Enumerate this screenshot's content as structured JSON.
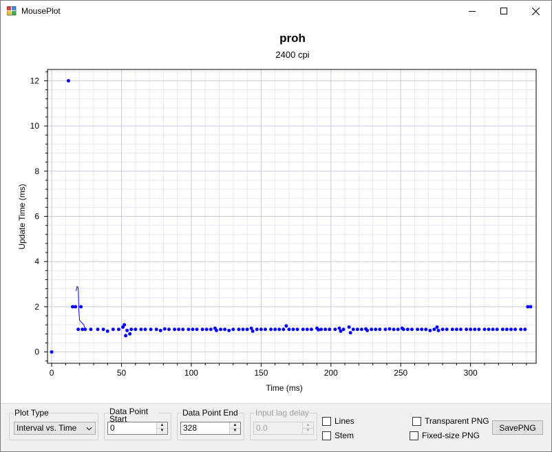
{
  "window": {
    "title": "MousePlot"
  },
  "chart": {
    "title": "proh",
    "subtitle": "2400 cpi",
    "xlabel": "Time (ms)",
    "ylabel": "Update Time (ms)",
    "xticks": [
      "0",
      "50",
      "100",
      "150",
      "200",
      "250",
      "300"
    ],
    "yticks": [
      "0",
      "2",
      "4",
      "6",
      "8",
      "10",
      "12"
    ],
    "point_color": "#0000ff"
  },
  "chart_data": {
    "type": "scatter",
    "title": "proh",
    "subtitle": "2400 cpi",
    "xlabel": "Time (ms)",
    "ylabel": "Update Time (ms)",
    "xlim": [
      -3,
      347
    ],
    "ylim": [
      -0.5,
      12.5
    ],
    "grid": true,
    "points": [
      [
        0,
        0
      ],
      [
        12,
        12
      ],
      [
        15,
        2
      ],
      [
        17,
        2
      ],
      [
        19,
        1
      ],
      [
        21,
        2
      ],
      [
        22,
        1
      ],
      [
        24,
        1
      ],
      [
        28,
        1
      ],
      [
        33,
        1
      ],
      [
        37,
        1
      ],
      [
        40,
        0.92
      ],
      [
        44,
        1
      ],
      [
        48,
        1
      ],
      [
        51,
        1.1
      ],
      [
        52,
        1.2
      ],
      [
        53,
        0.72
      ],
      [
        54,
        0.95
      ],
      [
        56,
        0.8
      ],
      [
        57,
        1
      ],
      [
        60,
        1
      ],
      [
        64,
        1
      ],
      [
        67,
        1
      ],
      [
        71,
        1
      ],
      [
        75,
        1
      ],
      [
        78,
        0.95
      ],
      [
        81,
        1.02
      ],
      [
        84,
        1
      ],
      [
        88,
        1
      ],
      [
        91,
        1
      ],
      [
        94,
        1
      ],
      [
        98,
        1
      ],
      [
        101,
        1
      ],
      [
        104,
        1
      ],
      [
        108,
        1
      ],
      [
        111,
        1
      ],
      [
        114,
        1
      ],
      [
        117,
        1.05
      ],
      [
        118,
        0.95
      ],
      [
        121,
        1
      ],
      [
        124,
        1
      ],
      [
        127,
        0.95
      ],
      [
        130,
        1
      ],
      [
        134,
        1
      ],
      [
        137,
        1
      ],
      [
        140,
        1
      ],
      [
        143,
        1.05
      ],
      [
        144,
        0.92
      ],
      [
        147,
        1
      ],
      [
        150,
        1
      ],
      [
        153,
        1
      ],
      [
        157,
        1
      ],
      [
        160,
        1
      ],
      [
        163,
        1
      ],
      [
        166,
        1
      ],
      [
        168,
        1.15
      ],
      [
        170,
        1
      ],
      [
        173,
        1
      ],
      [
        176,
        1
      ],
      [
        180,
        1
      ],
      [
        183,
        1
      ],
      [
        186,
        1
      ],
      [
        190,
        1.05
      ],
      [
        191,
        0.98
      ],
      [
        193,
        1
      ],
      [
        196,
        1
      ],
      [
        199,
        1
      ],
      [
        203,
        1
      ],
      [
        206,
        1.05
      ],
      [
        207,
        0.92
      ],
      [
        209,
        1
      ],
      [
        213,
        1.1
      ],
      [
        214,
        0.85
      ],
      [
        216,
        1
      ],
      [
        219,
        1
      ],
      [
        222,
        1
      ],
      [
        225,
        1.02
      ],
      [
        226,
        0.95
      ],
      [
        229,
        1
      ],
      [
        232,
        1
      ],
      [
        235,
        1
      ],
      [
        239,
        1
      ],
      [
        242,
        1.02
      ],
      [
        245,
        1
      ],
      [
        248,
        1
      ],
      [
        251,
        1.05
      ],
      [
        252,
        1
      ],
      [
        255,
        1
      ],
      [
        258,
        1
      ],
      [
        262,
        1
      ],
      [
        265,
        1
      ],
      [
        268,
        1
      ],
      [
        271,
        0.95
      ],
      [
        274,
        1
      ],
      [
        276,
        1.1
      ],
      [
        277,
        0.95
      ],
      [
        280,
        1
      ],
      [
        283,
        1
      ],
      [
        287,
        1
      ],
      [
        290,
        1
      ],
      [
        293,
        1
      ],
      [
        297,
        1
      ],
      [
        300,
        1
      ],
      [
        303,
        1
      ],
      [
        306,
        1
      ],
      [
        310,
        1
      ],
      [
        313,
        1
      ],
      [
        316,
        1
      ],
      [
        319,
        1
      ],
      [
        323,
        1
      ],
      [
        326,
        1
      ],
      [
        329,
        1
      ],
      [
        332,
        1
      ],
      [
        336,
        1
      ],
      [
        339,
        1
      ],
      [
        341,
        2
      ],
      [
        343,
        2
      ]
    ],
    "line": [
      [
        17.5,
        2.7
      ],
      [
        18.2,
        2.9
      ],
      [
        19,
        2.85
      ],
      [
        19.5,
        1.8
      ],
      [
        20,
        1.4
      ],
      [
        21.5,
        1.3
      ],
      [
        23,
        1.2
      ],
      [
        24,
        1
      ]
    ]
  },
  "controls": {
    "plot_type": {
      "label": "Plot Type",
      "value": "Interval vs. Time"
    },
    "data_start": {
      "label": "Data Point Start",
      "value": "0"
    },
    "data_end": {
      "label": "Data Point End",
      "value": "328"
    },
    "lag_delay": {
      "label": "Input lag delay",
      "value": "0.0"
    },
    "lines": {
      "label": "Lines",
      "checked": false
    },
    "stem": {
      "label": "Stem",
      "checked": false
    },
    "transparent_png": {
      "label": "Transparent PNG",
      "checked": false
    },
    "fixed_png": {
      "label": "Fixed-size PNG",
      "checked": false
    },
    "save_button": "SavePNG"
  }
}
